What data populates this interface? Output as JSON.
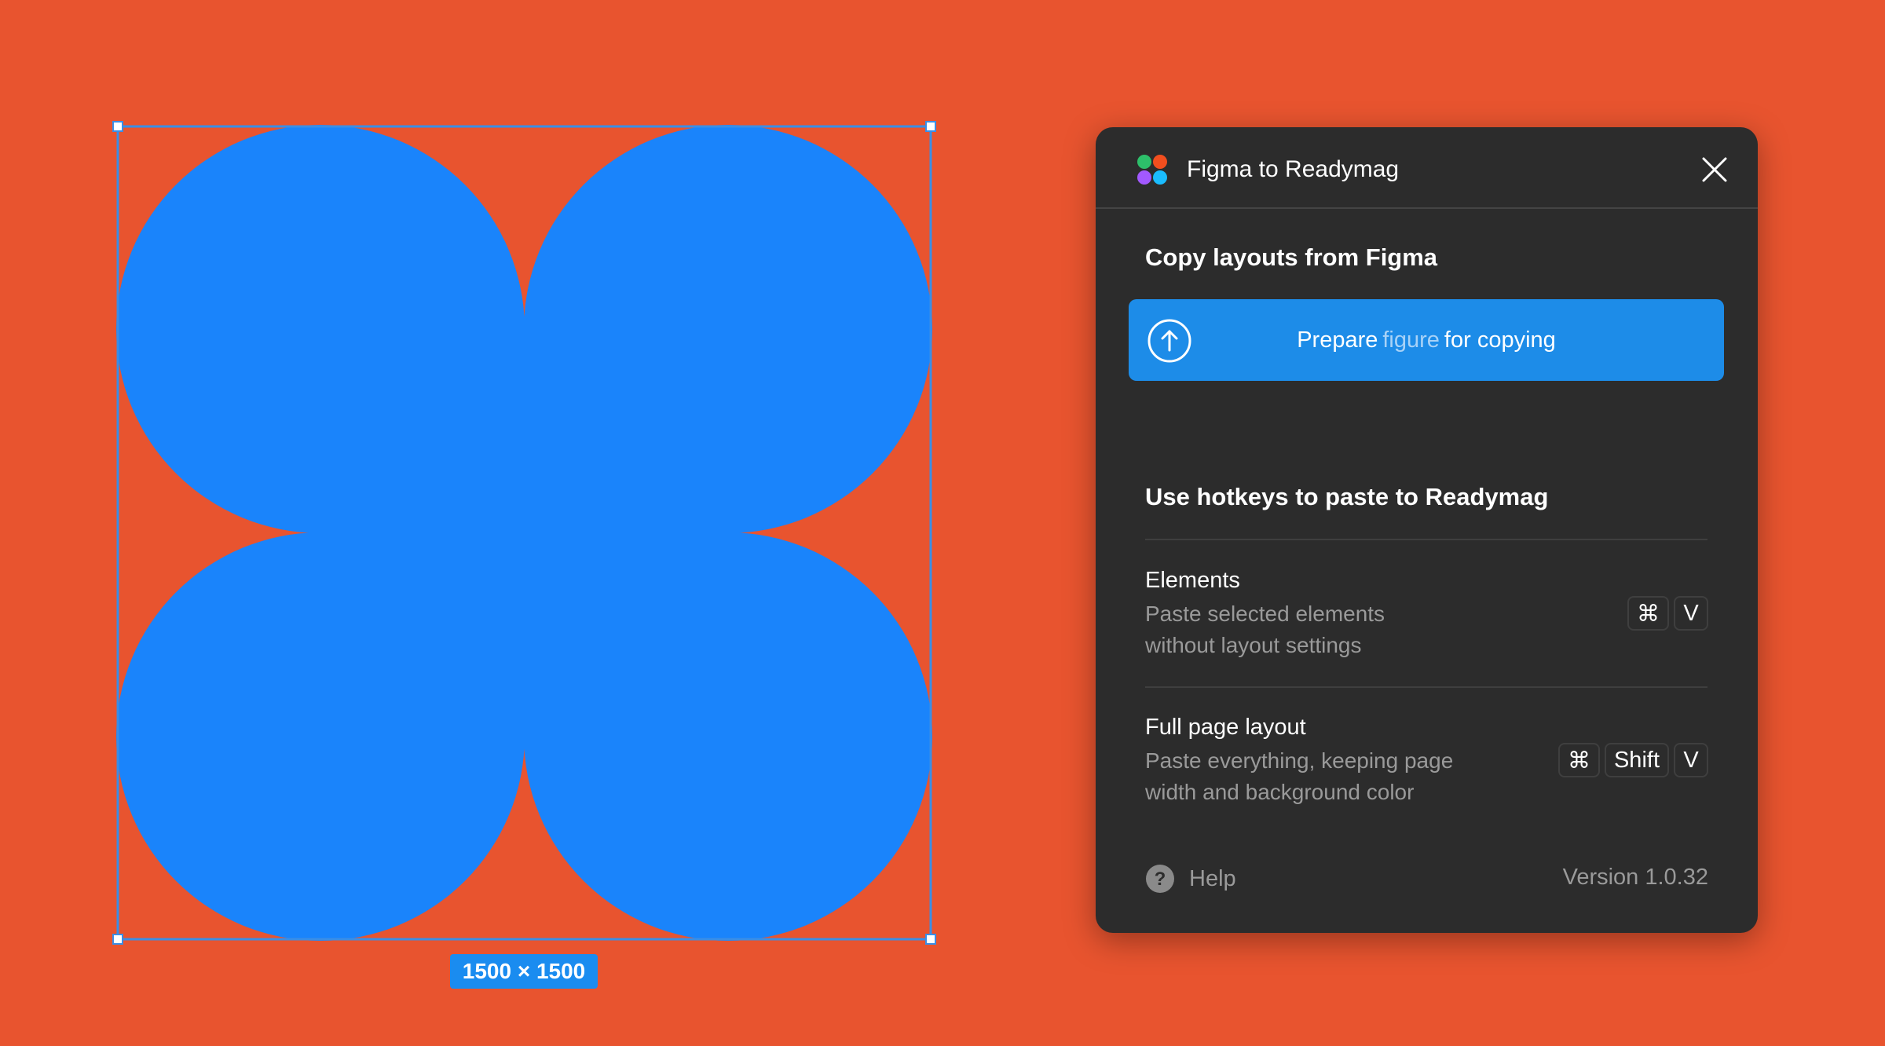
{
  "colors": {
    "background": "#e8542f",
    "shape_fill": "#1a84fb",
    "selection": "#3a8ee6",
    "panel_bg": "#2c2c2c",
    "button_blue": "#1d8ce8",
    "muted_text": "#9a9a9a"
  },
  "canvas": {
    "size_badge": "1500 × 1500"
  },
  "plugin": {
    "title": "Figma to Readymag",
    "logo_icon": "figma-logo-icon",
    "close_icon": "close-icon",
    "copy_section": {
      "title": "Copy layouts from Figma",
      "button": {
        "icon": "upload-arrow-icon",
        "prefix": "Prepare",
        "highlight": "figure",
        "suffix": "for copying"
      }
    },
    "hotkeys_section": {
      "title": "Use hotkeys to paste to Readymag",
      "items": [
        {
          "title": "Elements",
          "desc_line1": "Paste selected elements",
          "desc_line2": "without layout settings",
          "keys": [
            "⌘",
            "V"
          ]
        },
        {
          "title": "Full page layout",
          "desc_line1": "Paste everything, keeping page",
          "desc_line2": "width and background color",
          "keys": [
            "⌘",
            "Shift",
            "V"
          ]
        }
      ]
    },
    "footer": {
      "help_icon": "help-icon",
      "help_label": "Help",
      "version": "Version 1.0.32"
    }
  }
}
